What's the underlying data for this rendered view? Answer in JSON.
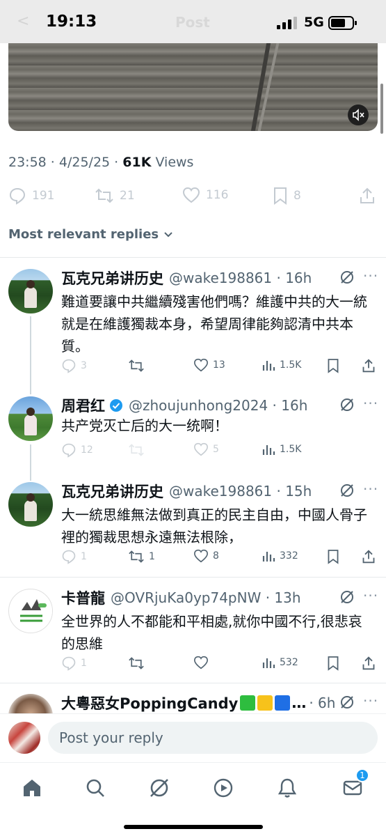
{
  "status_bar": {
    "time": "19:13",
    "network": "5G",
    "ghost_title": "Post",
    "ghost_back": "<"
  },
  "tweet": {
    "timestamp": "23:58 · 4/25/25 ·",
    "views_count": "61K",
    "views_label": "Views",
    "replies": "191",
    "reposts": "21",
    "likes": "116",
    "bookmarks": "8"
  },
  "sort_label": "Most relevant replies",
  "replies": [
    {
      "name": "瓦克兄弟讲历史",
      "handle": "@wake198861 · 16h",
      "text": "難道要讓中共繼續殘害他們嗎？維護中共的大一統就是在維護獨裁本身，希望周律能夠認清中共本質。",
      "replies": "3",
      "reposts": "",
      "likes": "13",
      "views": "1.5K"
    },
    {
      "name": "周君红",
      "handle": "@zhoujunhong2024 · 16h",
      "text": "共产党灭亡后的大一统啊！",
      "replies": "12",
      "reposts": "",
      "likes": "5",
      "views": "1.5K"
    },
    {
      "name": "瓦克兄弟讲历史",
      "handle": "@wake198861 · 15h",
      "text": "大一統思維無法做到真正的民主自由，中國人骨子裡的獨裁思想永遠無法根除，",
      "replies": "1",
      "reposts": "1",
      "likes": "8",
      "views": "332"
    },
    {
      "name": "卡普龍",
      "handle": "@OVRjuKa0yp74pNW · 13h",
      "text": "全世界的人不都能和平相處,就你中國不行,很悲哀的思維",
      "replies": "1",
      "reposts": "",
      "likes": "",
      "views": "532"
    },
    {
      "name": "大粵惡女PoppingCandy",
      "handle": "…",
      "time": "· 6h"
    }
  ],
  "reply_placeholder": "Post your reply",
  "nav": {
    "messages_badge": "1"
  },
  "colors": {
    "accent": "#1d9bf0",
    "text": "#0f1419",
    "secondary": "#536471"
  },
  "icons": [
    "home-icon",
    "search-icon",
    "grok-icon",
    "video-icon",
    "bell-icon",
    "mail-icon"
  ]
}
